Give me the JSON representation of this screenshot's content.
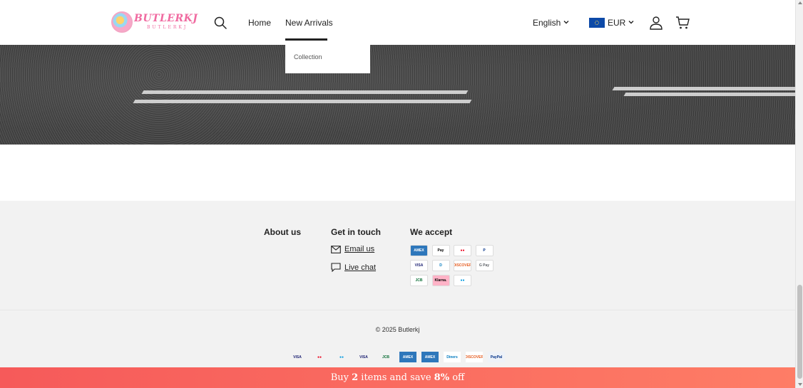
{
  "header": {
    "logo_text": "BUTLERKJ",
    "logo_subtext": "BUTLERKJ",
    "nav": [
      {
        "label": "Home"
      },
      {
        "label": "New Arrivals"
      }
    ],
    "language": "English",
    "currency": "EUR",
    "icons": [
      "search-icon",
      "account-icon",
      "cart-icon",
      "eu-flag-icon",
      "chevron-down-icon"
    ]
  },
  "dropdown": {
    "items": [
      {
        "label": "Collection"
      }
    ]
  },
  "footer": {
    "about_heading": "About us",
    "touch_heading": "Get in touch",
    "email_label": "Email us",
    "chat_label": "Live chat",
    "accept_heading": "We accept",
    "payment_methods": [
      {
        "name": "amex",
        "label": "AMEX",
        "bg": "#2e77bb",
        "fg": "#ffffff"
      },
      {
        "name": "apple-pay",
        "label": "Pay",
        "bg": "#ffffff",
        "fg": "#000000"
      },
      {
        "name": "mastercard",
        "label": "●●",
        "bg": "#ffffff",
        "fg": "#eb001b"
      },
      {
        "name": "paypal",
        "label": "P",
        "bg": "#ffffff",
        "fg": "#003087"
      },
      {
        "name": "visa",
        "label": "VISA",
        "bg": "#ffffff",
        "fg": "#1a1f71"
      },
      {
        "name": "diners",
        "label": "D",
        "bg": "#ffffff",
        "fg": "#0079be"
      },
      {
        "name": "discover",
        "label": "DISCOVER",
        "bg": "#ffffff",
        "fg": "#e55c20"
      },
      {
        "name": "google-pay",
        "label": "G Pay",
        "bg": "#ffffff",
        "fg": "#5f6368"
      },
      {
        "name": "jcb",
        "label": "JCB",
        "bg": "#ffffff",
        "fg": "#0b6e35"
      },
      {
        "name": "klarna",
        "label": "Klarna.",
        "bg": "#ffb3c7",
        "fg": "#000000"
      },
      {
        "name": "maestro",
        "label": "●●",
        "bg": "#ffffff",
        "fg": "#0099df"
      }
    ],
    "copyright": "© 2025 Butlerkj",
    "bottom_payments": [
      {
        "name": "visa",
        "label": "VISA",
        "fg": "#1a1f71",
        "bg": "transparent"
      },
      {
        "name": "mastercard",
        "label": "●●",
        "fg": "#eb001b",
        "bg": "transparent"
      },
      {
        "name": "maestro",
        "label": "●●",
        "fg": "#0099df",
        "bg": "transparent"
      },
      {
        "name": "visa-electron",
        "label": "VISA",
        "fg": "#1a1f71",
        "bg": "transparent"
      },
      {
        "name": "jcb",
        "label": "JCB",
        "fg": "#0b6e35",
        "bg": "transparent"
      },
      {
        "name": "amex",
        "label": "AMEX",
        "fg": "#ffffff",
        "bg": "#2e77bb"
      },
      {
        "name": "amex-card",
        "label": "AMEX",
        "fg": "#ffffff",
        "bg": "#2e77bb"
      },
      {
        "name": "diners",
        "label": "Diners",
        "fg": "#0079be",
        "bg": "#ffffff"
      },
      {
        "name": "discover",
        "label": "DISCOVER",
        "fg": "#e55c20",
        "bg": "#ffffff"
      },
      {
        "name": "paypal",
        "label": "PayPal",
        "fg": "#003087",
        "bg": "#eef2f8"
      }
    ]
  },
  "promo": {
    "prefix": "Buy ",
    "count": "2",
    "middle": " items and save ",
    "percent": "8%",
    "suffix": " off"
  },
  "colors": {
    "promo_start": "#f65a5a",
    "promo_end": "#fe7d66",
    "brand_pink": "#f06aa0"
  }
}
